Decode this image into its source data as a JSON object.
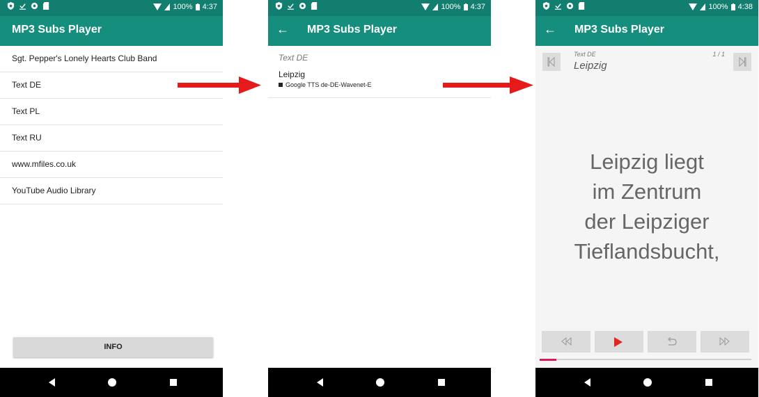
{
  "colors": {
    "status_bar": "#117e6f",
    "app_bar": "#168e7d",
    "arrow": "#e51b1b",
    "play": "#e52420",
    "progress": "#d81b60"
  },
  "screens": [
    {
      "status": {
        "battery": "100%",
        "time": "4:37"
      },
      "app_title": "MP3 Subs Player",
      "list": [
        "Sgt. Pepper's Lonely Hearts Club Band",
        "Text DE",
        "Text PL",
        "Text RU",
        "www.mfiles.co.uk",
        "YouTube Audio Library"
      ],
      "info_button": "INFO"
    },
    {
      "status": {
        "battery": "100%",
        "time": "4:37"
      },
      "app_title": "MP3 Subs Player",
      "list_name": "Text DE",
      "track": {
        "title": "Leipzig",
        "voice": "Google TTS de-DE-Wavenet-E"
      }
    },
    {
      "status": {
        "battery": "100%",
        "time": "4:38"
      },
      "app_title": "MP3 Subs Player",
      "list_name": "Text DE",
      "track_title": "Leipzig",
      "counter": "1 / 1",
      "subtitle_lines": [
        "Leipzig liegt",
        "im Zentrum",
        "der Leipziger",
        "Tieflandsbucht,"
      ],
      "progress": 0.08
    }
  ]
}
